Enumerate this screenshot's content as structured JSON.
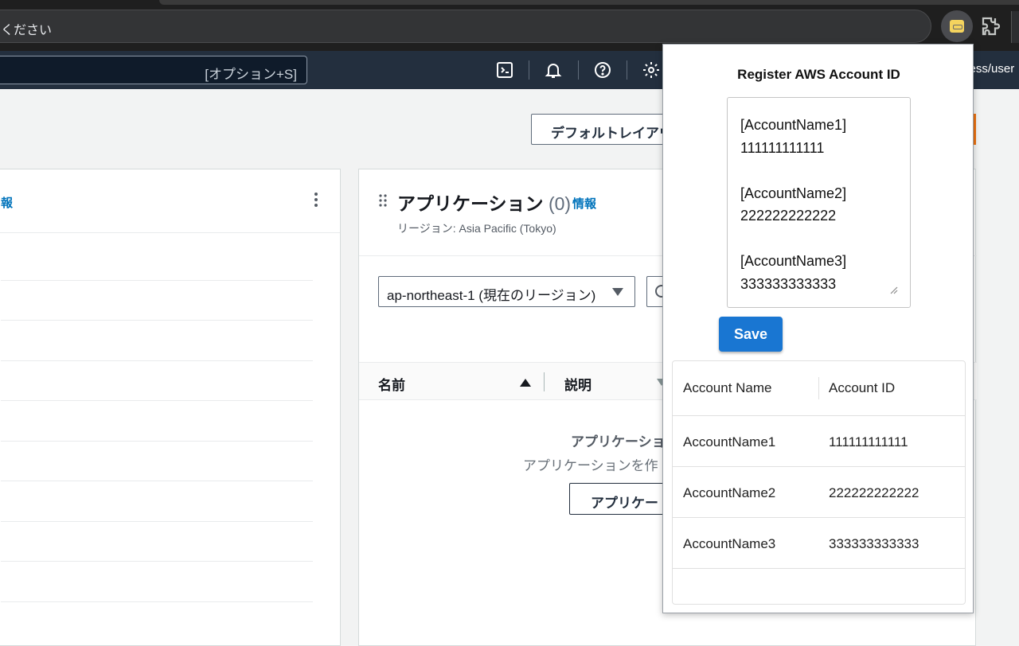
{
  "browser": {
    "omnibox_text": "ください",
    "extension_icon": "extension-badge-icon",
    "puzzle_icon": "puzzle-icon"
  },
  "aws_header": {
    "search_hint": "[オプション+S]",
    "icons": [
      "cloudshell-icon",
      "bell-icon",
      "help-icon",
      "gear-icon"
    ],
    "right_text": "cess/user"
  },
  "page": {
    "default_layout_button": "デフォルトレイアウト",
    "left_panel_info": "報",
    "applications": {
      "title": "アプリケーション",
      "count": "(0)",
      "info": "情報",
      "region_label": "リージョン: Asia Pacific (Tokyo)",
      "region_select": "ap-northeast-1 (現在のリージョン)",
      "columns": [
        "名前",
        "説明"
      ],
      "empty_title": "アプリケーショ",
      "empty_desc": "アプリケーションを作",
      "create_button": "アプリケー"
    }
  },
  "popup": {
    "title": "Register AWS Account ID",
    "textarea_value": "[AccountName1]\n111111111111\n\n[AccountName2]\n222222222222\n\n[AccountName3]\n333333333333",
    "save_label": "Save",
    "table": {
      "headers": [
        "Account Name",
        "Account ID"
      ],
      "rows": [
        {
          "name": "AccountName1",
          "id": "111111111111"
        },
        {
          "name": "AccountName2",
          "id": "222222222222"
        },
        {
          "name": "AccountName3",
          "id": "333333333333"
        }
      ]
    }
  },
  "colors": {
    "aws_header": "#232f3e",
    "link": "#0073bb",
    "save_button": "#1976d2",
    "accent_orange": "#ec7211"
  }
}
